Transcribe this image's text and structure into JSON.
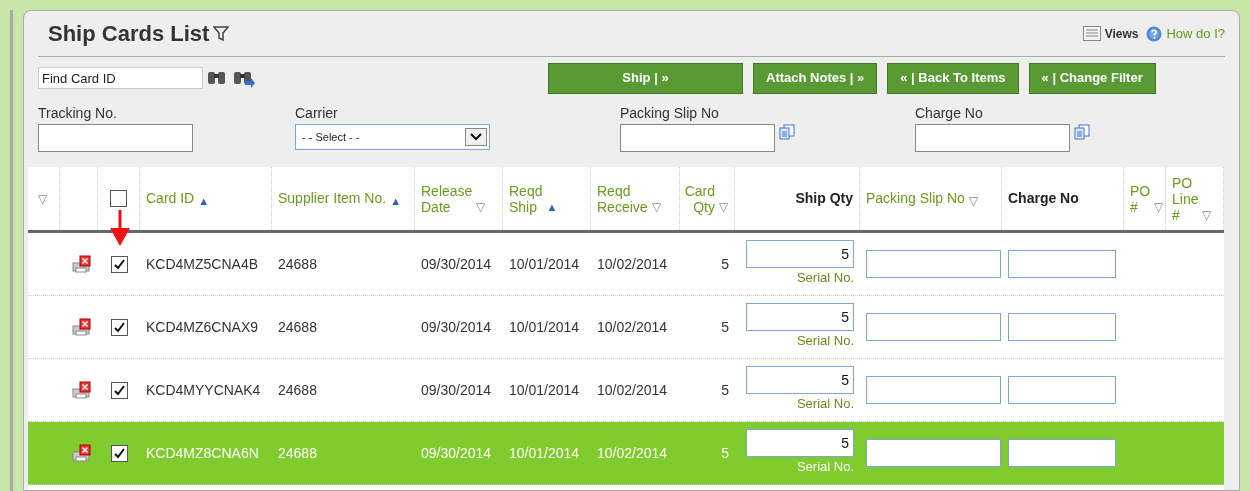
{
  "page": {
    "title": "Ship Cards List"
  },
  "header_links": [
    {
      "kind": "views",
      "label": "Views"
    },
    {
      "kind": "help",
      "label": "How do I?"
    }
  ],
  "search": {
    "value": "Find Card ID"
  },
  "buttons": [
    {
      "label": "Ship | »"
    },
    {
      "label": "Attach Notes | »"
    },
    {
      "label": "« | Back To Items"
    },
    {
      "label": "« | Change Filter"
    }
  ],
  "filters": [
    {
      "kind": "text",
      "label": "Tracking No."
    },
    {
      "kind": "select",
      "label": "Carrier",
      "value": "- - Select - -"
    },
    {
      "kind": "lookup",
      "label": "Packing Slip No"
    },
    {
      "kind": "lookup",
      "label": "Charge No"
    }
  ],
  "table": {
    "header_checkbox": {
      "checked": false
    },
    "first_column_sort": {
      "symbol": "▽",
      "kind": "desc"
    },
    "columns": [
      {
        "label": "Card ID",
        "kind": "link",
        "sort": {
          "symbol": "▲",
          "kind": "asc"
        }
      },
      {
        "label": "Supplier Item No.",
        "kind": "link",
        "sort": {
          "symbol": "▲",
          "kind": "asc"
        }
      },
      {
        "label": "Release Date",
        "kind": "link",
        "sort": {
          "symbol": "▽",
          "kind": "desc"
        }
      },
      {
        "label": "Reqd Ship",
        "kind": "link",
        "sort": {
          "symbol": "▲",
          "kind": "asc"
        }
      },
      {
        "label": "Reqd Receive",
        "kind": "link",
        "sort": {
          "symbol": "▽",
          "kind": "desc"
        }
      },
      {
        "label": "Card Qty",
        "kind": "link",
        "sort": {
          "symbol": "▽",
          "kind": "desc"
        }
      },
      {
        "label": "Ship Qty",
        "kind": "plain"
      },
      {
        "label": "Packing Slip No",
        "kind": "link",
        "sort": {
          "symbol": "▽",
          "kind": "desc"
        }
      },
      {
        "label": "Charge No",
        "kind": "plain"
      },
      {
        "label": "PO #",
        "kind": "link",
        "sort": {
          "symbol": "▽",
          "kind": "desc"
        }
      },
      {
        "label": "PO Line #",
        "kind": "link",
        "sort": {
          "symbol": "▽",
          "kind": "desc"
        }
      }
    ],
    "rows": [
      {
        "card_id": "KCD4MZ5CNA4B",
        "supplier_item": "24688",
        "release_date": "09/30/2014",
        "reqd_ship": "10/01/2014",
        "reqd_receive": "10/02/2014",
        "card_qty": "5",
        "ship_qty": "5",
        "serial_label": "Serial No.",
        "checked": true,
        "selected": false
      },
      {
        "card_id": "KCD4MZ6CNAX9",
        "supplier_item": "24688",
        "release_date": "09/30/2014",
        "reqd_ship": "10/01/2014",
        "reqd_receive": "10/02/2014",
        "card_qty": "5",
        "ship_qty": "5",
        "serial_label": "Serial No.",
        "checked": true,
        "selected": false
      },
      {
        "card_id": "KCD4MYYCNAK4",
        "supplier_item": "24688",
        "release_date": "09/30/2014",
        "reqd_ship": "10/01/2014",
        "reqd_receive": "10/02/2014",
        "card_qty": "5",
        "ship_qty": "5",
        "serial_label": "Serial No.",
        "checked": true,
        "selected": false
      },
      {
        "card_id": "KCD4MZ8CNA6N",
        "supplier_item": "24688",
        "release_date": "09/30/2014",
        "reqd_ship": "10/01/2014",
        "reqd_receive": "10/02/2014",
        "card_qty": "5",
        "ship_qty": "5",
        "serial_label": "Serial No.",
        "checked": true,
        "selected": true
      }
    ]
  }
}
